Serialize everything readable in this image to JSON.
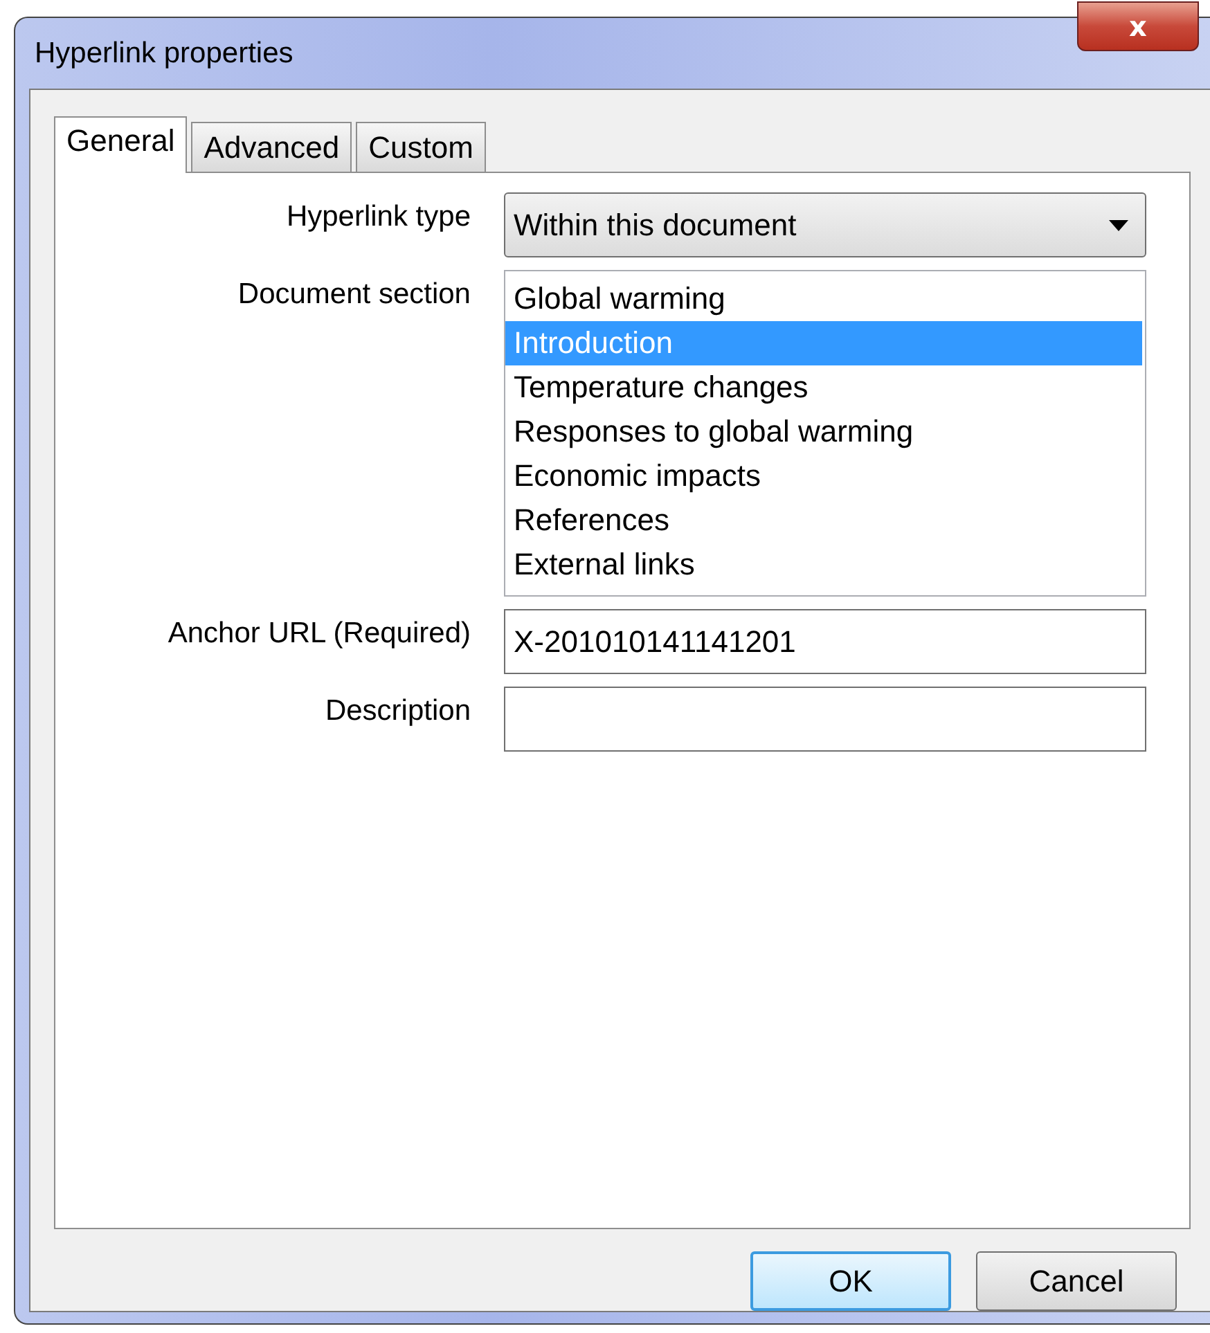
{
  "window": {
    "title": "Hyperlink properties",
    "close": "x"
  },
  "tabs": [
    {
      "label": "General",
      "selected": true
    },
    {
      "label": "Advanced",
      "selected": false
    },
    {
      "label": "Custom",
      "selected": false
    }
  ],
  "form": {
    "hyperlink_type": {
      "label": "Hyperlink type",
      "value": "Within this document"
    },
    "document_section": {
      "label": "Document section",
      "items": [
        {
          "label": "Global warming",
          "selected": false
        },
        {
          "label": "Introduction",
          "selected": true
        },
        {
          "label": "Temperature changes",
          "selected": false
        },
        {
          "label": "Responses to global warming",
          "selected": false
        },
        {
          "label": "Economic impacts",
          "selected": false
        },
        {
          "label": "References",
          "selected": false
        },
        {
          "label": "External links",
          "selected": false
        }
      ]
    },
    "anchor_url": {
      "label": "Anchor URL (Required)",
      "value": "X-201010141141201"
    },
    "description": {
      "label": "Description"
    }
  },
  "buttons": [
    {
      "label": "OK",
      "default": true
    },
    {
      "label": "Cancel",
      "default": false
    }
  ]
}
